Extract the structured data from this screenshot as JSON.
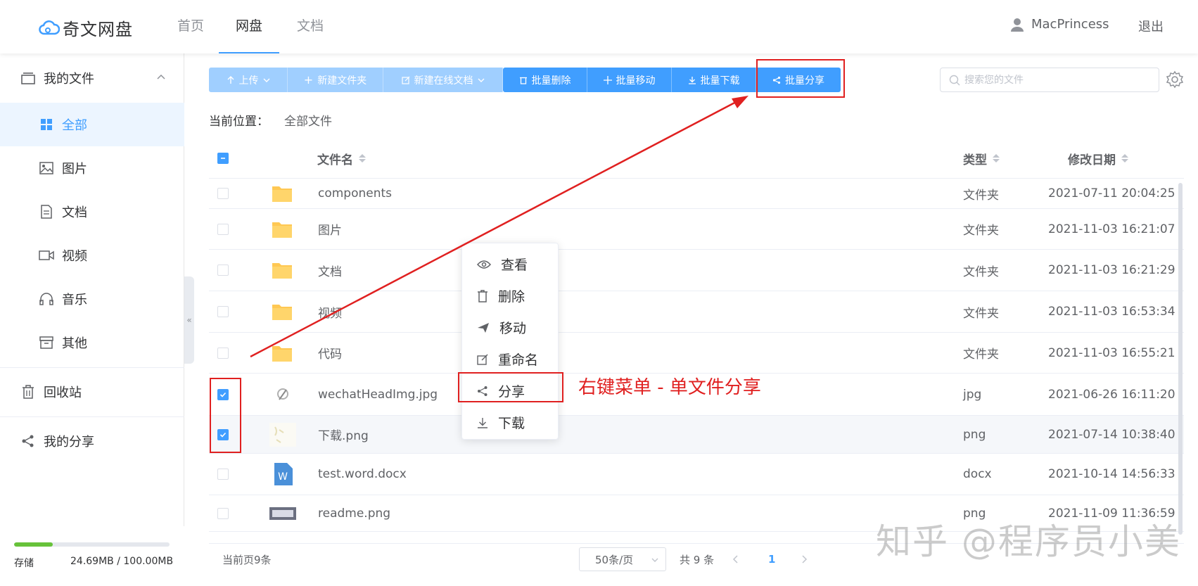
{
  "app": {
    "logo_text": "奇文网盘",
    "nav": [
      {
        "label": "首页",
        "active": false
      },
      {
        "label": "网盘",
        "active": true
      },
      {
        "label": "文档",
        "active": false
      }
    ],
    "user_name": "MacPrincess",
    "logout_label": "退出"
  },
  "sidebar": {
    "my_files": "我的文件",
    "categories": [
      {
        "label": "全部",
        "icon": "grid-icon",
        "active": true
      },
      {
        "label": "图片",
        "icon": "image-icon",
        "active": false
      },
      {
        "label": "文档",
        "icon": "document-icon",
        "active": false
      },
      {
        "label": "视频",
        "icon": "video-icon",
        "active": false
      },
      {
        "label": "音乐",
        "icon": "headphones-icon",
        "active": false
      },
      {
        "label": "其他",
        "icon": "archive-icon",
        "active": false
      }
    ],
    "recycle_bin": "回收站",
    "my_share": "我的分享",
    "storage_label": "存储",
    "storage_value": "24.69MB / 100.00MB",
    "storage_ratio": 0.2469,
    "storage_color": "#67c23a"
  },
  "toolbar": {
    "upload": "上传",
    "new_folder": "新建文件夹",
    "new_online_doc": "新建在线文档",
    "batch_delete": "批量删除",
    "batch_move": "批量移动",
    "batch_download": "批量下载",
    "batch_share": "批量分享",
    "search_placeholder": "搜索您的文件"
  },
  "breadcrumb": {
    "label": "当前位置：",
    "path": "全部文件"
  },
  "table": {
    "headers": {
      "name": "文件名",
      "type": "类型",
      "date": "修改日期"
    },
    "rows": [
      {
        "name": "components",
        "type": "文件夹",
        "date": "2021-07-11 20:04:25",
        "checked": false,
        "icon": "folder-icon"
      },
      {
        "name": "图片",
        "type": "文件夹",
        "date": "2021-11-03 16:21:07",
        "checked": false,
        "icon": "folder-icon"
      },
      {
        "name": "文档",
        "type": "文件夹",
        "date": "2021-11-03 16:21:29",
        "checked": false,
        "icon": "folder-icon"
      },
      {
        "name": "视频",
        "type": "文件夹",
        "date": "2021-11-03 16:53:34",
        "checked": false,
        "icon": "folder-icon"
      },
      {
        "name": "代码",
        "type": "文件夹",
        "date": "2021-11-03 16:55:21",
        "checked": false,
        "icon": "folder-icon"
      },
      {
        "name": "wechatHeadImg.jpg",
        "type": "jpg",
        "date": "2021-06-26 16:11:20",
        "checked": true,
        "icon": "image-thumbnail"
      },
      {
        "name": "下载.png",
        "type": "png",
        "date": "2021-07-14 10:38:40",
        "checked": true,
        "icon": "image-thumbnail"
      },
      {
        "name": "test.word.docx",
        "type": "docx",
        "date": "2021-10-14 14:56:33",
        "checked": false,
        "icon": "word-icon"
      },
      {
        "name": "readme.png",
        "type": "png",
        "date": "2021-11-09 11:36:59",
        "checked": false,
        "icon": "image-thumbnail"
      }
    ]
  },
  "pagination": {
    "current_count": "当前页9条",
    "page_size": "50条/页",
    "total": "共 9 条",
    "current_page": "1"
  },
  "context_menu": {
    "items": [
      {
        "label": "查看",
        "icon": "eye-icon"
      },
      {
        "label": "删除",
        "icon": "trash-icon"
      },
      {
        "label": "移动",
        "icon": "send-icon"
      },
      {
        "label": "重命名",
        "icon": "edit-icon"
      },
      {
        "label": "分享",
        "icon": "share-icon"
      },
      {
        "label": "下载",
        "icon": "download-icon"
      }
    ]
  },
  "annotation": {
    "text": "右键菜单 - 单文件分享",
    "color": "#e02020"
  },
  "watermark": "知乎 @程序员小美",
  "colors": {
    "primary": "#409eff",
    "primary_light": "#a0cfff",
    "folder": "#ffc853"
  }
}
